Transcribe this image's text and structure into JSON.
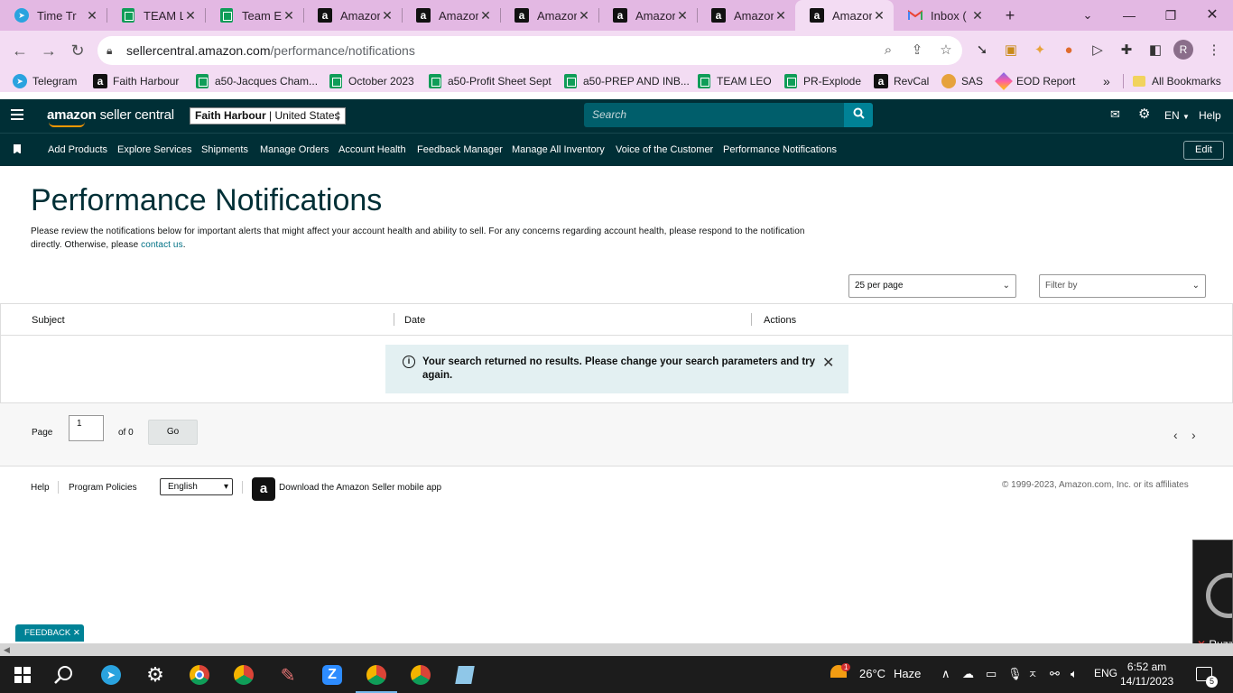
{
  "browser": {
    "tabs": [
      {
        "label": "Time Tr",
        "icon": "telegram-icon"
      },
      {
        "label": "TEAM L",
        "icon": "sheets-icon"
      },
      {
        "label": "Team Ex",
        "icon": "sheets-icon"
      },
      {
        "label": "Amazor",
        "icon": "amazon-icon"
      },
      {
        "label": "Amazor",
        "icon": "amazon-icon"
      },
      {
        "label": "Amazor",
        "icon": "amazon-icon"
      },
      {
        "label": "Amazor",
        "icon": "amazon-icon"
      },
      {
        "label": "Amazor",
        "icon": "amazon-icon"
      },
      {
        "label": "Amazor",
        "icon": "amazon-icon",
        "active": true
      },
      {
        "label": "Inbox (",
        "icon": "gmail-icon"
      }
    ],
    "url_host": "sellercentral.amazon.com",
    "url_path": "/performance/notifications",
    "profile_initial": "R",
    "bookmarks": [
      {
        "label": "Telegram",
        "icon": "telegram-icon"
      },
      {
        "label": "Faith Harbour",
        "icon": "amazon-icon"
      },
      {
        "label": "a50-Jacques Cham...",
        "icon": "sheets-icon"
      },
      {
        "label": "October 2023",
        "icon": "sheets-icon"
      },
      {
        "label": "a50-Profit Sheet Sept",
        "icon": "sheets-icon"
      },
      {
        "label": "a50-PREP AND INB...",
        "icon": "sheets-icon"
      },
      {
        "label": "TEAM LEO",
        "icon": "sheets-icon"
      },
      {
        "label": "PR-Explode",
        "icon": "sheets-icon"
      },
      {
        "label": "RevCal",
        "icon": "amazon-icon"
      },
      {
        "label": "SAS",
        "icon": "sas-icon"
      },
      {
        "label": "EOD Report",
        "icon": "clickup-icon"
      }
    ],
    "more_bookmarks": "»",
    "all_bookmarks": "All Bookmarks"
  },
  "header": {
    "logo_bold": "amazon",
    "logo_rest": " seller central",
    "store_name": "Faith Harbour",
    "store_region": " | United States",
    "search_placeholder": "Search",
    "language": "EN",
    "help": "Help"
  },
  "subnav": {
    "links": [
      "Add Products",
      "Explore Services",
      "Shipments",
      "Manage Orders",
      "Account Health",
      "Feedback Manager",
      "Manage All Inventory",
      "Voice of the Customer",
      "Performance Notifications"
    ],
    "edit": "Edit"
  },
  "main": {
    "title": "Performance Notifications",
    "description": "Please review the notifications below for important alerts that might affect your account health and ability to sell. For any concerns regarding account health, please respond to the notification directly. Otherwise, please ",
    "contact_link": "contact us",
    "description_end": ".",
    "per_page": "25 per page",
    "filter_by": "Filter by",
    "columns": [
      "Subject",
      "Date",
      "Actions"
    ],
    "alert_message": "Your search returned no results. Please change your search parameters and try again."
  },
  "pager": {
    "page_label": "Page",
    "page_value": "1",
    "of_label": "of 0",
    "go": "Go"
  },
  "footer": {
    "help": "Help",
    "program_policies": "Program Policies",
    "language": "English",
    "download_app": "Download the Amazon Seller mobile app",
    "copyright": "© 1999-2023, Amazon.com, Inc. or its affiliates",
    "feedback": "FEEDBACK"
  },
  "video_overlay": {
    "name": "Ruzz"
  },
  "taskbar": {
    "weather_temp": "26°C",
    "weather_text": "Haze",
    "language": "ENG",
    "time": "6:52 am",
    "date": "14/11/2023",
    "notification_count": "5",
    "weather_badge": "1"
  }
}
